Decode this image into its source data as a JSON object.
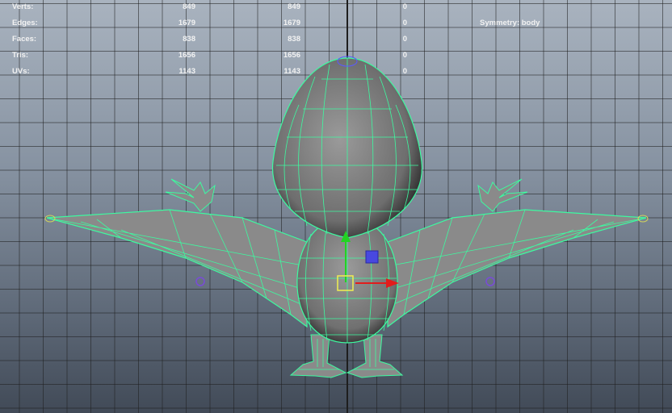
{
  "hud": {
    "rows": [
      {
        "label": "Verts:",
        "v1": "849",
        "v2": "849",
        "v3": "0"
      },
      {
        "label": "Edges:",
        "v1": "1679",
        "v2": "1679",
        "v3": "0"
      },
      {
        "label": "Faces:",
        "v1": "838",
        "v2": "838",
        "v3": "0"
      },
      {
        "label": "Tris:",
        "v1": "1656",
        "v2": "1656",
        "v3": "0"
      },
      {
        "label": "UVs:",
        "v1": "1143",
        "v2": "1143",
        "v3": "0"
      }
    ],
    "symmetry": "Symmetry: body"
  },
  "colors": {
    "wireframe": "#3dfaa0",
    "mesh_fill": "#8d8d8d",
    "manipulator_x": "#e21c1c",
    "manipulator_y": "#22d422",
    "manipulator_center": "#f0f050",
    "handle_blue": "#5a5aff",
    "joint": "#7a4bd8"
  }
}
